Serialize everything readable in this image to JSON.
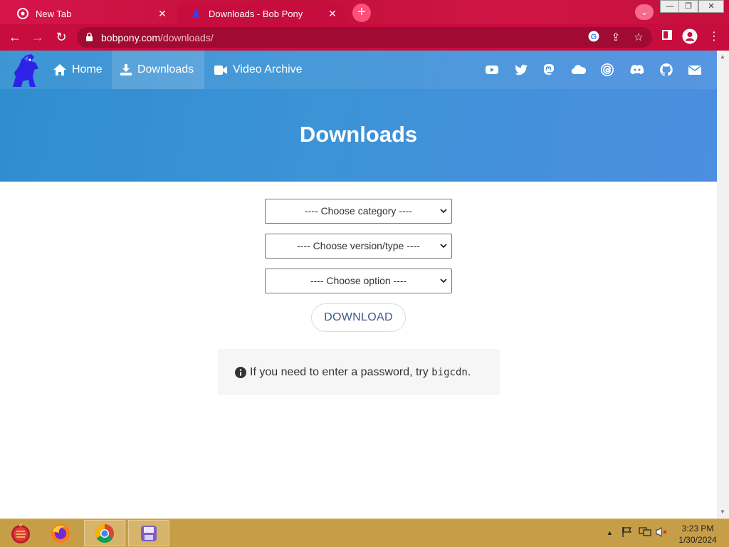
{
  "browser": {
    "tabs": [
      {
        "title": "New Tab",
        "active": false
      },
      {
        "title": "Downloads - Bob Pony",
        "active": true
      }
    ],
    "url_host": "bobpony.com",
    "url_path": "/downloads/"
  },
  "site": {
    "nav": [
      {
        "label": "Home",
        "icon": "home-icon"
      },
      {
        "label": "Downloads",
        "icon": "download-icon"
      },
      {
        "label": "Video Archive",
        "icon": "video-camera-icon"
      }
    ],
    "social_icons": [
      "youtube-icon",
      "twitter-icon",
      "mastodon-icon",
      "cloud-icon",
      "threads-icon",
      "discord-icon",
      "github-icon",
      "email-icon"
    ],
    "title": "Downloads"
  },
  "form": {
    "category": "---- Choose category ----",
    "version": "---- Choose version/type ----",
    "option": "---- Choose option ----",
    "download_label": "DOWNLOAD"
  },
  "info": {
    "text_before": "If you need to enter a password, try",
    "password": "bigcdn",
    "text_after": "."
  },
  "taskbar": {
    "time": "3:23 PM",
    "date": "1/30/2024"
  },
  "colors": {
    "browser_accent": "#c70d3d",
    "hero_blue": "#3c93d6",
    "taskbar": "#c79e48"
  }
}
